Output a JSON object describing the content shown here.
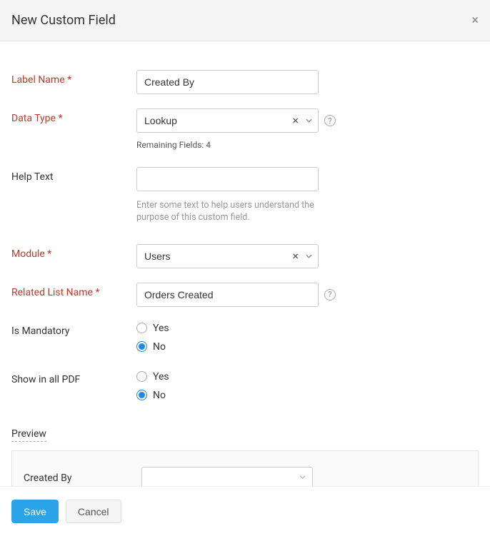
{
  "dialog": {
    "title": "New Custom Field"
  },
  "form": {
    "label_name": {
      "label": "Label Name",
      "star": "*",
      "value": "Created By"
    },
    "data_type": {
      "label": "Data Type",
      "star": "*",
      "value": "Lookup",
      "remaining": "Remaining Fields: 4"
    },
    "help_text": {
      "label": "Help Text",
      "value": "",
      "hint": "Enter some text to help users understand the purpose of this custom field."
    },
    "module": {
      "label": "Module",
      "star": "*",
      "value": "Users"
    },
    "related_list": {
      "label": "Related List Name",
      "star": "*",
      "value": "Orders Created"
    },
    "mandatory": {
      "label": "Is Mandatory",
      "yes": "Yes",
      "no": "No"
    },
    "show_pdf": {
      "label": "Show in all PDF",
      "yes": "Yes",
      "no": "No"
    }
  },
  "preview": {
    "title": "Preview",
    "field_label": "Created By"
  },
  "footer": {
    "save": "Save",
    "cancel": "Cancel"
  },
  "icons": {
    "help": "?",
    "close": "×",
    "clear": "×"
  }
}
